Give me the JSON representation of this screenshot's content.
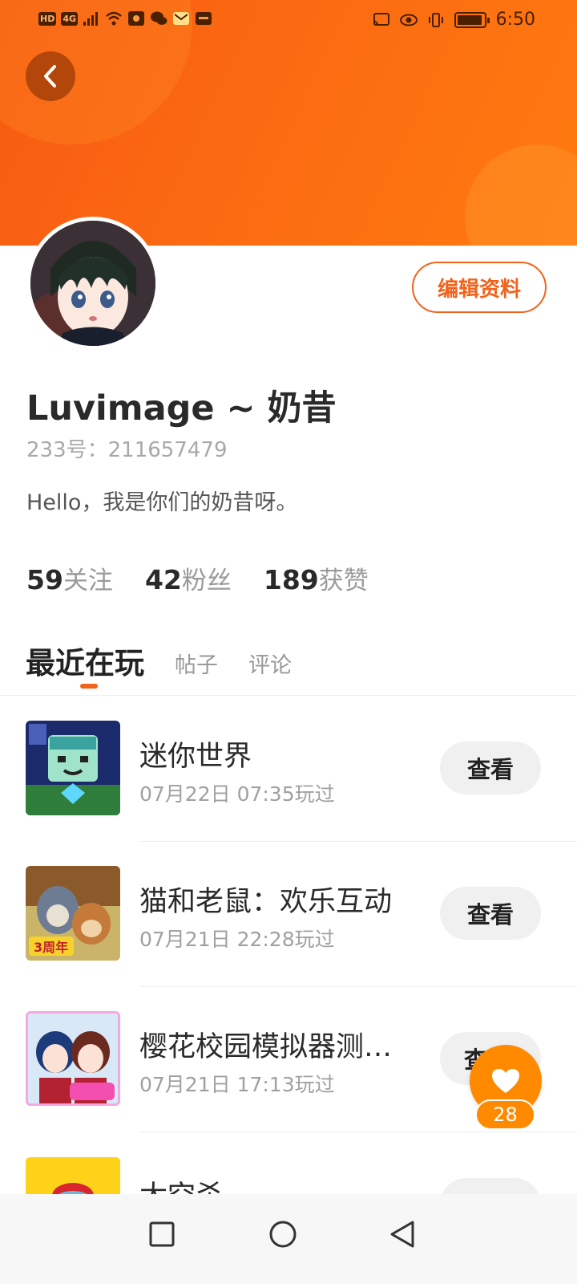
{
  "status_bar": {
    "left_chips": [
      "HD",
      "4G"
    ],
    "time": "6:50"
  },
  "profile": {
    "username": "Luvimage ~ 奶昔",
    "uid": "233号：211657479",
    "bio": "Hello，我是你们的奶昔呀。",
    "edit_label": "编辑资料",
    "stats": [
      {
        "num": "59",
        "label": "关注"
      },
      {
        "num": "42",
        "label": "粉丝"
      },
      {
        "num": "189",
        "label": "获赞"
      }
    ]
  },
  "tabs": {
    "active": "最近在玩",
    "others": [
      "帖子",
      "评论"
    ]
  },
  "games": [
    {
      "title": "迷你世界",
      "time": "07月22日 07:35玩过",
      "button": "查看",
      "icon": "mini-world-icon"
    },
    {
      "title": "猫和老鼠：欢乐互动",
      "time": "07月21日 22:28玩过",
      "button": "查看",
      "icon": "tom-and-jerry-icon"
    },
    {
      "title": "樱花校园模拟器测…",
      "time": "07月21日 17:13玩过",
      "button": "查",
      "icon": "sakura-school-icon"
    },
    {
      "title": "太空杀",
      "time": "",
      "button": "",
      "icon": "space-kill-icon"
    }
  ],
  "like_fab": {
    "count": "28"
  },
  "colors": {
    "accent": "#f2621b",
    "header_start": "#f75a12",
    "header_end": "#ff7a10",
    "fab": "#ff8a00"
  }
}
